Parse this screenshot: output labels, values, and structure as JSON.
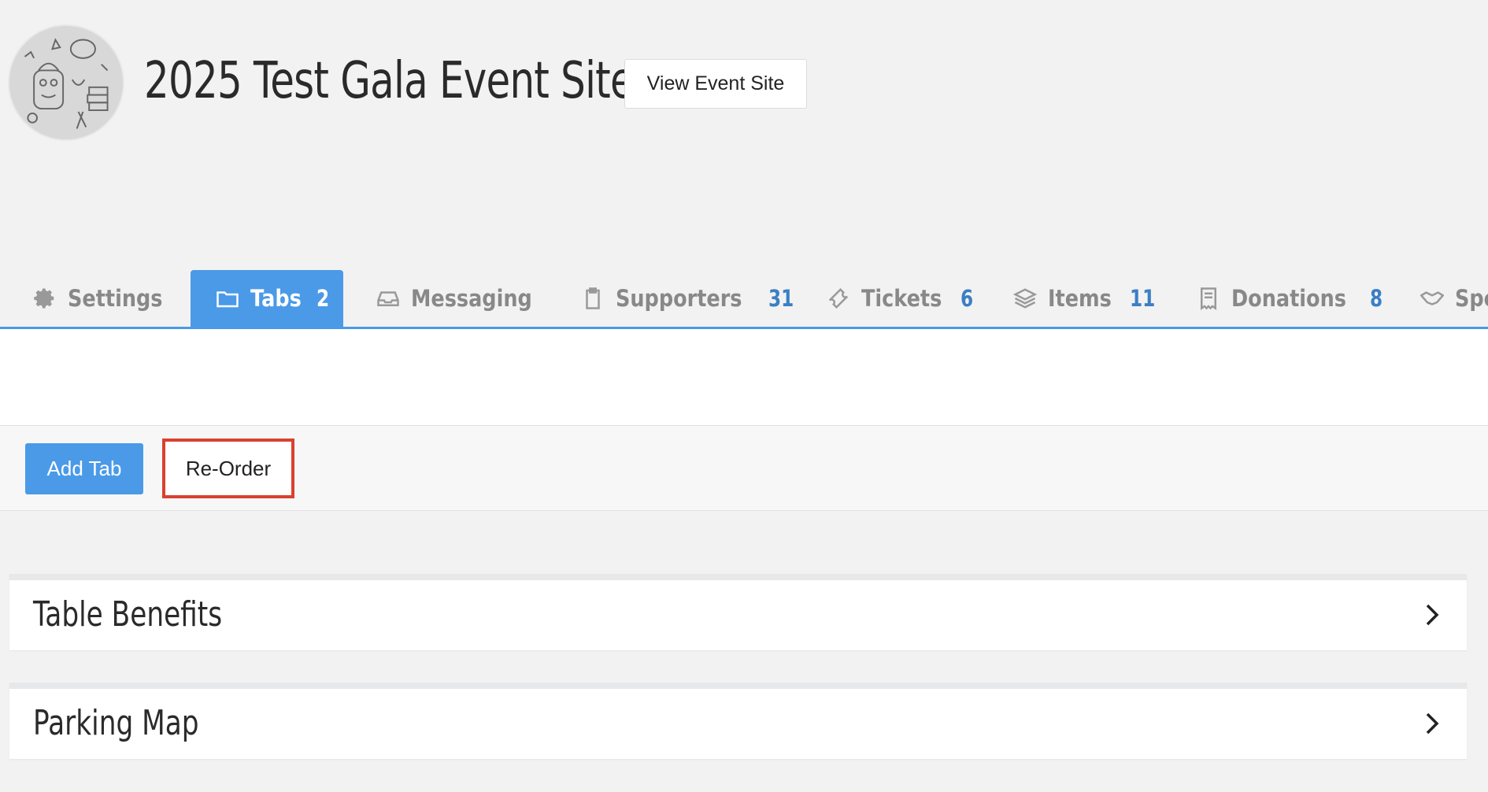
{
  "header": {
    "event_title": "2025 Test Gala Event Site",
    "view_site_label": "View Event Site"
  },
  "tabs": [
    {
      "label": "Settings",
      "count": "",
      "icon": "gear-icon",
      "active": false
    },
    {
      "label": "Tabs",
      "count": "2",
      "icon": "folder-icon",
      "active": true
    },
    {
      "label": "Messaging",
      "count": "",
      "icon": "inbox-icon",
      "active": false
    },
    {
      "label": "Supporters",
      "count": "31",
      "icon": "clipboard-icon",
      "active": false
    },
    {
      "label": "Tickets",
      "count": "6",
      "icon": "ticket-icon",
      "active": false
    },
    {
      "label": "Items",
      "count": "11",
      "icon": "layers-icon",
      "active": false
    },
    {
      "label": "Donations",
      "count": "8",
      "icon": "receipt-icon",
      "active": false
    },
    {
      "label": "Spe",
      "count": "",
      "icon": "handshake-icon",
      "active": false
    }
  ],
  "toolbar": {
    "add_tab_label": "Add Tab",
    "reorder_label": "Re-Order"
  },
  "panels": [
    {
      "title": "Table Benefits"
    },
    {
      "title": "Parking Map"
    }
  ],
  "colors": {
    "accent": "#4a9ae8",
    "count_blue": "#3b7fc4",
    "highlight_border": "#d9412f",
    "background": "#f2f2f2"
  }
}
